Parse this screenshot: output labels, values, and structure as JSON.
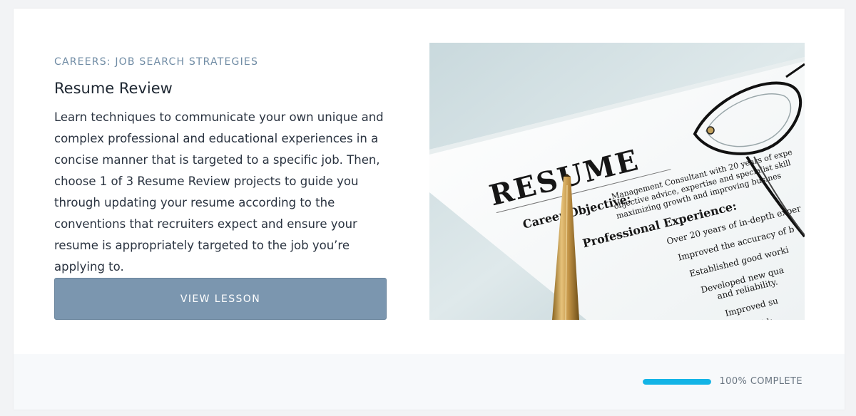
{
  "lesson": {
    "category": "CAREERS: JOB SEARCH STRATEGIES",
    "title": "Resume Review",
    "description": "Learn techniques to communicate your own unique and complex professional and educational experiences in a concise manner that is targeted to a specific job. Then, choose 1 of 3 Resume Review projects to guide you through updating your resume according to the conventions that recruiters expect and ensure your resume is appropriately targeted to the job you’re applying to.",
    "button_label": "VIEW LESSON"
  },
  "image": {
    "heading": "RESUME",
    "career_objective": "Career Objective:",
    "objective_line1": "Management Consultant with 20 years of expe",
    "objective_line2": "objective advice, expertise and specialist skill",
    "objective_line3": "maximizing growth and improving busines",
    "experience_heading": "Professional Experience:",
    "bullets": [
      "Over 20 years of in-depth exper",
      "Improved the accuracy of b",
      "Established good worki",
      "Developed new qua",
      "and reliability.",
      "Improved su",
      "well-k"
    ]
  },
  "progress": {
    "percent": 100,
    "label": "100% COMPLETE"
  },
  "colors": {
    "category": "#6f8ba4",
    "button": "#7b96af",
    "progress_fill": "#13b4e6",
    "footer_bg": "#f7f9fb"
  }
}
